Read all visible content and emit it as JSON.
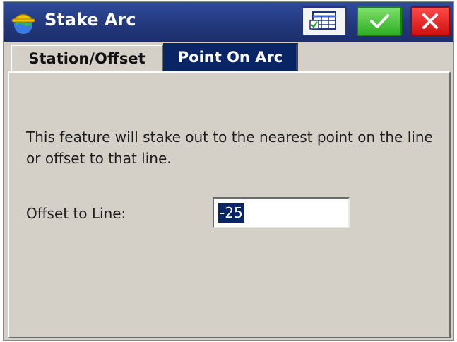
{
  "window": {
    "title": "Stake Arc",
    "icons": {
      "app": "hardhat-globe-icon",
      "table": "table-checklist-icon",
      "ok": "checkmark-icon",
      "cancel": "close-icon"
    },
    "colors": {
      "titlebar": "#22377a",
      "ok": "#2fae25",
      "cancel": "#d01010",
      "active_tab": "#0a2565"
    }
  },
  "tabs": [
    {
      "label": "Station/Offset",
      "active": false
    },
    {
      "label": "Point On Arc",
      "active": true
    }
  ],
  "content": {
    "description": "This feature will stake out to the nearest point on the line or offset to that line.",
    "offset_label": "Offset to Line:",
    "offset_value": "-25"
  }
}
